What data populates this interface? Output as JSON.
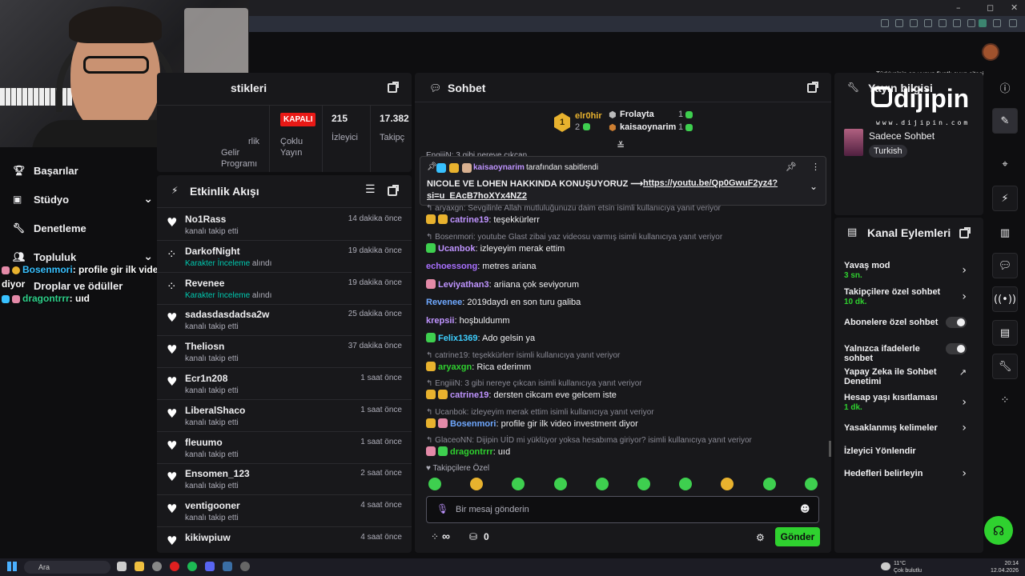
{
  "browser": {
    "window_controls": [
      "–",
      "◻",
      "✕"
    ]
  },
  "promo": {
    "tagline": "Türkiye'nin en uygun fiyatlı oyun sitesi",
    "brand": "dijipin",
    "url": "www.dijipin.com"
  },
  "left_nav": {
    "items": [
      {
        "label": "Başarılar",
        "icon": "trophy-icon"
      },
      {
        "label": "Stüdyo",
        "icon": "video-icon"
      },
      {
        "label": "Denetleme",
        "icon": "wrench-icon"
      },
      {
        "label": "Topluluk",
        "icon": "people-icon"
      },
      {
        "label": "Droplar ve ödüller",
        "icon": "gift-icon"
      }
    ]
  },
  "stream_overlay": {
    "messages": [
      {
        "user": "Bosenmori",
        "text": ": profile gir ilk video investment diyor"
      },
      {
        "user": "dragontrrr",
        "text": ": uıd"
      }
    ]
  },
  "stats": {
    "title": "stikleri",
    "cells": [
      {
        "label": "Gelir Programı",
        "label_top": "rlik"
      },
      {
        "badge": "KAPALI",
        "label": "Çoklu Yayın"
      },
      {
        "value": "215",
        "label": "İzleyici"
      },
      {
        "value": "17.382",
        "label": "Takipç"
      }
    ]
  },
  "activity": {
    "title": "Etkinlik Akışı",
    "rows": [
      {
        "name": "No1Rass",
        "sub": "kanalı takip etti",
        "time": "14 dakika önce",
        "icon": "heart-icon"
      },
      {
        "name": "DarkofNight",
        "sub_hl": "Karakter İnceleme",
        "sub": " alındı",
        "time": "19 dakika önce",
        "icon": "points-icon"
      },
      {
        "name": "Revenee",
        "sub_hl": "Karakter İnceleme",
        "sub": " alındı",
        "time": "19 dakika önce",
        "icon": "points-icon"
      },
      {
        "name": "sadasdasdadsa2w",
        "sub": "kanalı takip etti",
        "time": "25 dakika önce",
        "icon": "heart-icon"
      },
      {
        "name": "Theliosn",
        "sub": "kanalı takip etti",
        "time": "37 dakika önce",
        "icon": "heart-icon"
      },
      {
        "name": "Ecr1n208",
        "sub": "kanalı takip etti",
        "time": "1 saat önce",
        "icon": "heart-icon"
      },
      {
        "name": "LiberalShaco",
        "sub": "kanalı takip etti",
        "time": "1 saat önce",
        "icon": "heart-icon"
      },
      {
        "name": "fleuumo",
        "sub": "kanalı takip etti",
        "time": "1 saat önce",
        "icon": "heart-icon"
      },
      {
        "name": "Ensomen_123",
        "sub": "kanalı takip etti",
        "time": "2 saat önce",
        "icon": "heart-icon"
      },
      {
        "name": "ventigooner",
        "sub": "kanalı takip etti",
        "time": "4 saat önce",
        "icon": "heart-icon"
      },
      {
        "name": "kikiwpiuw",
        "sub": "",
        "time": "4 saat önce",
        "icon": "heart-icon"
      }
    ]
  },
  "chat": {
    "title": "Sohbet",
    "leaderboard": {
      "first": {
        "name": "elr0hir",
        "count": "2"
      },
      "second": {
        "name": "Frolayta",
        "count": "1"
      },
      "third": {
        "name": "kaisaoynarim",
        "count": "1"
      },
      "rank": "1"
    },
    "partial_line": "EngiiiN: 3 gibi nereye çıkcan",
    "pinned": {
      "by_user": "kaisaoynarim",
      "by_text": " tarafından sabitlendi",
      "text": "NICOLE VE LOHEN HAKKINDA KONUŞUYORUZ ⟶ ",
      "link1": "https://youtu.be/Qp0GwuF2yz4?",
      "link2": "si=u_EAcB7hoXYx4NZ2"
    },
    "messages": [
      {
        "reply": "aryaxgn: Sevgilinle Allah mutluluğunuzu daim etsin isimli kullanıcıya yanıt veriyor",
        "user": "catrine19",
        "color": "#bf94ff",
        "text": ": teşekkürlerr",
        "badges": [
          "gold",
          "gold"
        ]
      },
      {
        "reply": "Bosenmori: youtube Glast zibai yaz videosu varmış isimli kullanıcıya yanıt veriyor",
        "user": "Ucanbok",
        "color": "#bf94ff",
        "text": ": izleyeyim merak ettim",
        "badges": [
          "green"
        ]
      },
      {
        "user": "echoessong",
        "color": "#a970ff",
        "text": ": metres ariana",
        "badges": []
      },
      {
        "user": "Leviyathan3",
        "color": "#bf94ff",
        "text": ": ariiana çok seviyorum",
        "badges": [
          "pink"
        ]
      },
      {
        "user": "Revenee",
        "color": "#6fa8ff",
        "text": ": 2019daydı en son turu galiba",
        "badges": []
      },
      {
        "user": "krepsii",
        "color": "#bf94ff",
        "text": ": hoşbuldumm",
        "badges": []
      },
      {
        "user": "Felix1369",
        "color": "#3ecfff",
        "text": ": Ado gelsin ya",
        "badges": [
          "green"
        ]
      },
      {
        "reply": "catrine19: teşekkürlerr isimli kullanıcıya yanıt veriyor",
        "user": "aryaxgn",
        "color": "#2fd12f",
        "text": ": Rica ederimm",
        "badges": [
          "gold"
        ]
      },
      {
        "reply": "EngiiiN: 3 gibi nereye çıkcan isimli kullanıcıya yanıt veriyor",
        "user": "catrine19",
        "color": "#bf94ff",
        "text": ": dersten cikcam eve gelcem iste",
        "badges": [
          "gold",
          "gold"
        ]
      },
      {
        "reply": "Ucanbok: izleyeyim merak ettim isimli kullanıcıya yanıt veriyor",
        "user": "Bosenmori",
        "color": "#6fa8ff",
        "text": ": profile gir ilk video investment diyor",
        "badges": [
          "gold",
          "pink"
        ]
      },
      {
        "reply": "GlaceoNN: Dijipin UİD mi yüklüyor yoksa hesabıma giriyor? isimli kullanıcıya yanıt veriyor",
        "user": "dragontrrr",
        "color": "#2fd12f",
        "text": ": uıd",
        "badges": [
          "pink",
          "green"
        ]
      }
    ],
    "followers_only": "Takipçilere Özel",
    "input_placeholder": "Bir mesaj gönderin",
    "points": "∞",
    "drops_count": "0",
    "send_label": "Gönder",
    "emote_colors": [
      "#3ecf4f",
      "#e8b22e",
      "#3ecf4f",
      "#3ecf4f",
      "#3ecf4f",
      "#3ecf4f",
      "#3ecf4f",
      "#e8b22e",
      "#3ecf4f",
      "#3ecf4f"
    ]
  },
  "info": {
    "title": "Yayın bilgisi",
    "category": "Sadece Sohbet",
    "tag": "Turkish"
  },
  "actions": {
    "title": "Kanal Eylemleri",
    "items": [
      {
        "label": "Yavaş mod",
        "value": "3 sn.",
        "type": "chevron"
      },
      {
        "label": "Takipçilere özel sohbet",
        "value": "10 dk.",
        "type": "chevron"
      },
      {
        "label": "Abonelere özel sohbet",
        "type": "toggle"
      },
      {
        "label": "Yalnızca ifadelerle sohbet",
        "type": "toggle"
      },
      {
        "label": "Yapay Zeka ile Sohbet Denetimi",
        "type": "external"
      },
      {
        "label": "Hesap yaşı kısıtlaması",
        "value": "1 dk.",
        "type": "chevron"
      },
      {
        "label": "Yasaklanmış kelimeler",
        "type": "chevron"
      },
      {
        "label": "İzleyici Yönlendir",
        "type": "none"
      },
      {
        "label": "Hedefleri belirleyin",
        "type": "chevron"
      }
    ]
  },
  "taskbar": {
    "search_label": "Ara",
    "weather": "11°C",
    "weather_desc": "Çok bulutlu",
    "time": "20:14",
    "date": "12.04.2026"
  }
}
